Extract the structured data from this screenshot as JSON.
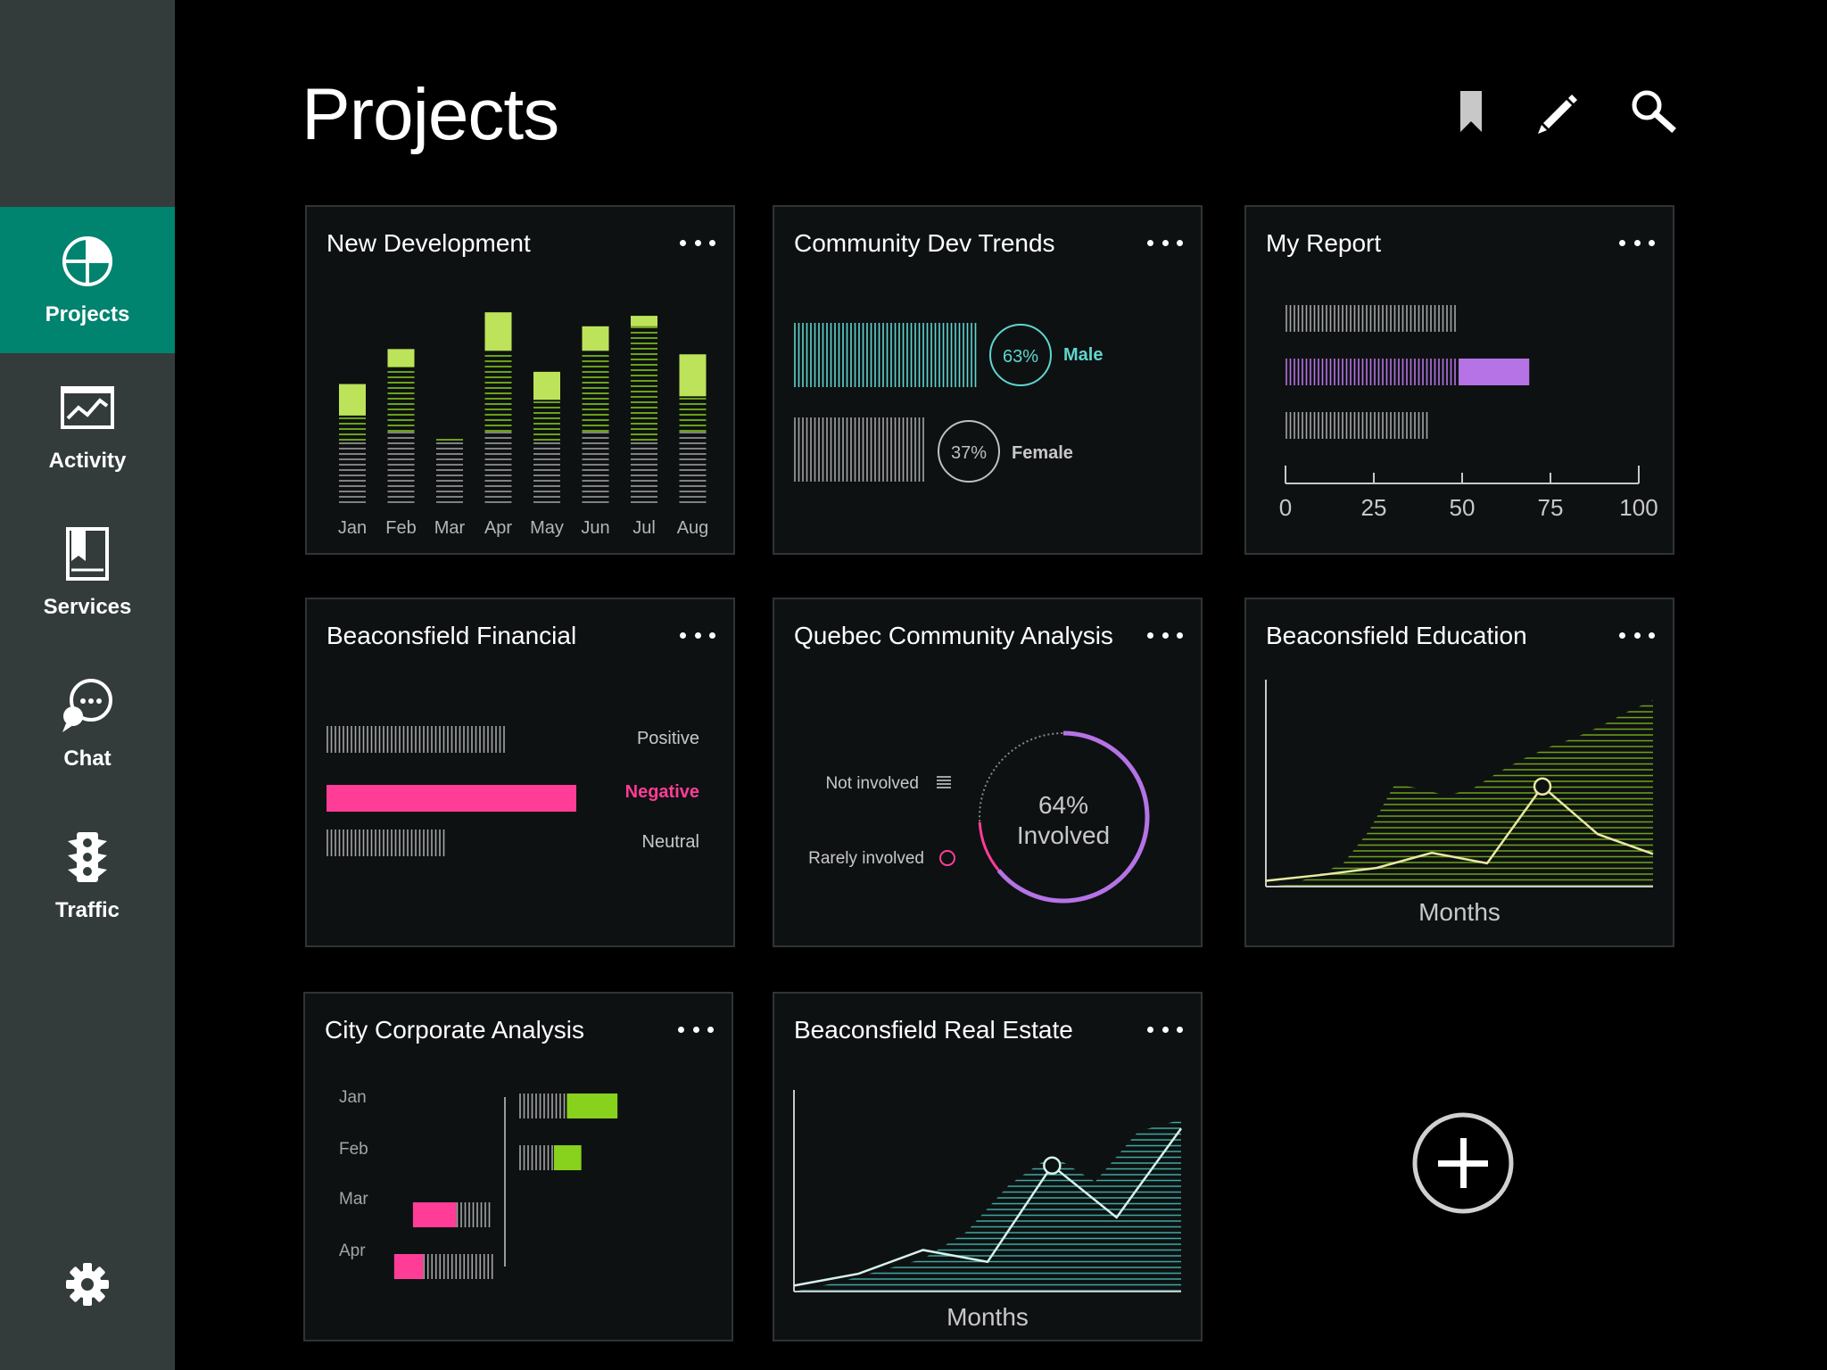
{
  "header": {
    "title": "Projects",
    "actions": [
      {
        "icon": "bookmark-icon"
      },
      {
        "icon": "pencil-icon"
      },
      {
        "icon": "search-icon"
      }
    ]
  },
  "sidebar": {
    "items": [
      {
        "label": "Projects",
        "icon": "pie-chart-icon",
        "active": true
      },
      {
        "label": "Activity",
        "icon": "activity-chart-icon",
        "active": false
      },
      {
        "label": "Services",
        "icon": "book-icon",
        "active": false
      },
      {
        "label": "Chat",
        "icon": "chat-bubbles-icon",
        "active": false
      },
      {
        "label": "Traffic",
        "icon": "traffic-light-icon",
        "active": false
      }
    ],
    "settings_icon": "gear-icon"
  },
  "colors": {
    "accent_teal": "#00836f",
    "lime": "#bde35a",
    "green": "#88d11d",
    "cyan": "#5fd6cf",
    "purple": "#b573e6",
    "pink": "#ff3d97",
    "gray_stripe": "#9a9a9a"
  },
  "cards": {
    "new_development": {
      "title": "New Development",
      "chart_data": {
        "type": "bar",
        "categories": [
          "Jan",
          "Feb",
          "Mar",
          "Apr",
          "May",
          "Jun",
          "Jul",
          "Aug"
        ],
        "series": [
          {
            "values": [
              100,
              156,
              74,
              174,
              118,
              174,
              202,
              122
            ]
          },
          {
            "values": [
              36,
              20,
              0,
              44,
              32,
              28,
              12,
              48
            ]
          }
        ],
        "ylim": [
          0,
          210
        ]
      }
    },
    "community_dev_trends": {
      "title": "Community Dev Trends",
      "chart_data": {
        "type": "bar",
        "categories": [
          "Male",
          "Female"
        ],
        "values": [
          63,
          37
        ],
        "value_labels": [
          "63%",
          "37%"
        ]
      }
    },
    "my_report": {
      "title": "My Report",
      "chart_data": {
        "type": "bar",
        "orientation": "horizontal",
        "series": [
          {
            "values": [
              49,
              49,
              41
            ]
          },
          {
            "values": [
              0,
              20,
              0
            ]
          }
        ],
        "x_ticks": [
          "0",
          "25",
          "50",
          "75",
          "100"
        ],
        "xlim": [
          0,
          100
        ]
      }
    },
    "beaconsfield_financial": {
      "title": "Beaconsfield Financial",
      "chart_data": {
        "type": "bar",
        "orientation": "horizontal",
        "categories": [
          "Positive",
          "Negative",
          "Neutral"
        ],
        "values": [
          72,
          100,
          47
        ],
        "highlight": "Negative"
      }
    },
    "quebec_community": {
      "title": "Quebec Community Analysis",
      "chart_data": {
        "type": "pie",
        "center_value": "64%",
        "center_label": "Involved",
        "categories": [
          "Involved",
          "Rarely involved",
          "Not involved"
        ],
        "values": [
          64,
          10,
          26
        ]
      }
    },
    "beaconsfield_education": {
      "title": "Beaconsfield Education",
      "chart_data": {
        "type": "area",
        "xlabel": "Months",
        "series": [
          {
            "kind": "area",
            "values": [
              0,
              2,
              10,
              20,
              48,
              88,
              84,
              78,
              84,
              98,
              110,
              120,
              128,
              138,
              150,
              160
            ]
          },
          {
            "kind": "line",
            "values": [
              5,
              10,
              16,
              29,
              20,
              86,
              45,
              28
            ]
          }
        ],
        "ylim": [
          0,
          170
        ]
      }
    },
    "city_corporate": {
      "title": "City Corporate Analysis",
      "chart_data": {
        "type": "bar",
        "orientation": "horizontal",
        "categories": [
          "Jan",
          "Feb",
          "Mar",
          "Apr"
        ],
        "values": [
          68,
          43,
          -55,
          -68
        ],
        "highlight_portion": [
          35,
          19,
          30,
          20
        ]
      }
    },
    "beaconsfield_real_estate": {
      "title": "Beaconsfield Real Estate",
      "chart_data": {
        "type": "area",
        "xlabel": "Months",
        "series": [
          {
            "kind": "area",
            "values": [
              0,
              6,
              14,
              22,
              40,
              72,
              92,
              74,
              108,
              116
            ]
          },
          {
            "kind": "line",
            "values": [
              4,
              12,
              28,
              20,
              85,
              50,
              110
            ]
          }
        ],
        "ylim": [
          0,
          130
        ]
      }
    }
  },
  "add_button_icon": "plus-circle-icon"
}
